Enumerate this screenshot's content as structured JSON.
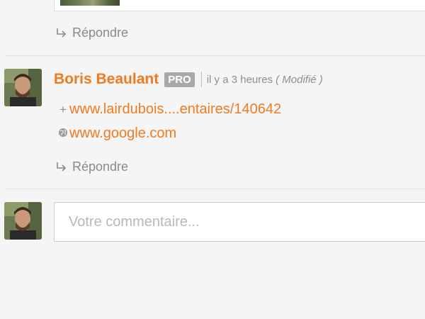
{
  "previous_comment": {
    "reply_label": "Répondre"
  },
  "comment": {
    "author": "Boris Beaulant",
    "badge": "PRO",
    "time": "il y a 3 heures",
    "modified": "( Modifié )",
    "links": [
      {
        "prefix": "+",
        "text": "www.lairdubois....entaires/140642",
        "icon": "plus-icon"
      },
      {
        "prefix": "",
        "text": "www.google.com",
        "icon": "globe-icon"
      }
    ],
    "reply_label": "Répondre"
  },
  "new_comment": {
    "placeholder": "Votre commentaire..."
  },
  "colors": {
    "accent": "#f07a1f",
    "badge_bg": "#a9a9a9",
    "muted_text": "#8f8f8f",
    "background": "#f5f5f5"
  }
}
